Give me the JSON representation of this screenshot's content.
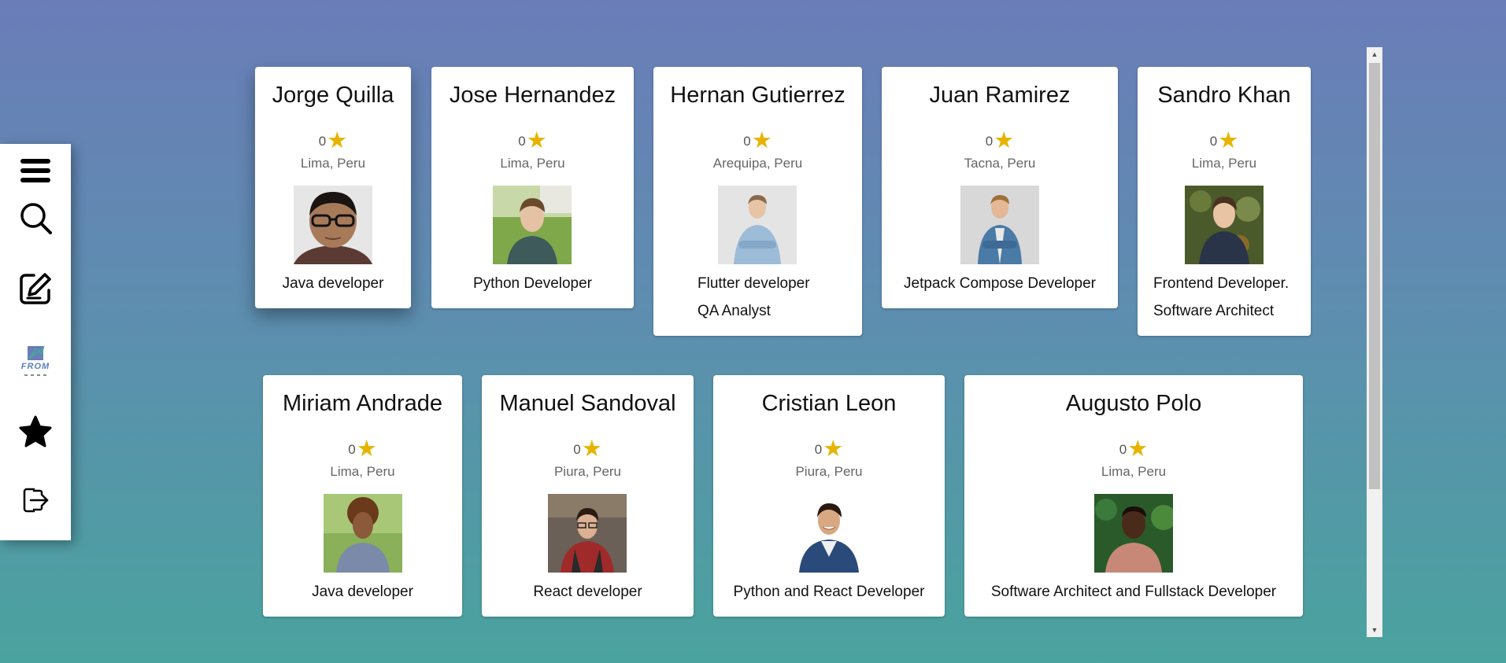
{
  "sidebar": {
    "items": [
      {
        "icon": "menu-icon"
      },
      {
        "icon": "search-icon"
      },
      {
        "icon": "edit-icon"
      },
      {
        "icon": "logo-icon",
        "logo_text": "FROM"
      },
      {
        "icon": "star-icon"
      },
      {
        "icon": "logout-icon"
      }
    ]
  },
  "cards": [
    {
      "name": "Jorge Quilla",
      "rating": "0",
      "location": "Lima, Peru",
      "roles": [
        "Java developer"
      ]
    },
    {
      "name": "Jose Hernandez",
      "rating": "0",
      "location": "Lima, Peru",
      "roles": [
        "Python Developer"
      ]
    },
    {
      "name": "Hernan Gutierrez",
      "rating": "0",
      "location": "Arequipa, Peru",
      "roles": [
        "Flutter developer",
        "QA Analyst"
      ]
    },
    {
      "name": "Juan Ramirez",
      "rating": "0",
      "location": "Tacna, Peru",
      "roles": [
        "Jetpack Compose Developer"
      ]
    },
    {
      "name": "Sandro Khan",
      "rating": "0",
      "location": "Lima, Peru",
      "roles": [
        "Frontend Developer.",
        "Software Architect"
      ]
    },
    {
      "name": "Miriam Andrade",
      "rating": "0",
      "location": "Lima, Peru",
      "roles": [
        "Java developer"
      ]
    },
    {
      "name": "Manuel Sandoval",
      "rating": "0",
      "location": "Piura, Peru",
      "roles": [
        "React developer"
      ]
    },
    {
      "name": "Cristian Leon",
      "rating": "0",
      "location": "Piura, Peru",
      "roles": [
        "Python and React Developer"
      ]
    },
    {
      "name": "Augusto Polo",
      "rating": "0",
      "location": "Lima, Peru",
      "roles": [
        "Software Architect and Fullstack Developer"
      ]
    }
  ],
  "colors": {
    "background_top": "#6a7db8",
    "background_bottom": "#4aa39e",
    "star": "#e6b400",
    "card": "#ffffff"
  }
}
